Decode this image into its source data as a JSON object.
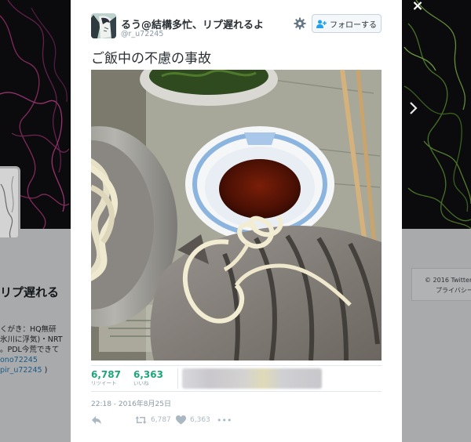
{
  "page": {
    "close_label": "×"
  },
  "background": {
    "profile_name": "リプ遅れる",
    "bio_lines": [
      "くがき：HQ無研",
      "氷川に浮気)・NRT",
      "。PDL今荒できて"
    ],
    "bio_link_1": "ono72245",
    "bio_link_2": "pir_u72245",
    "bio_link_2_suffix": " )",
    "footer_copyright": "© 2016 Twitter",
    "footer_privacy": "プライバシー"
  },
  "tweet": {
    "display_name": "るう@結構多忙、リプ遅れるよ",
    "handle": "@r_u72245",
    "follow_label": "フォローする",
    "text": "ご飯中の不慮の事故",
    "retweets": {
      "count": "6,787",
      "label": "リツイート"
    },
    "likes": {
      "count": "6,363",
      "label": "いいね"
    },
    "timestamp": "22:18 - 2016年8月25日",
    "action_retweet_count": "6,787",
    "action_like_count": "6,363",
    "more_label": "•••"
  },
  "icons": [
    "close-icon",
    "chevron-right-icon",
    "gear-icon",
    "follow-user-icon",
    "reply-icon",
    "retweet-icon",
    "heart-icon",
    "more-icon"
  ],
  "colors": {
    "stat_accent": "#1da57a",
    "muted": "#8899a6",
    "text": "#292f33"
  }
}
